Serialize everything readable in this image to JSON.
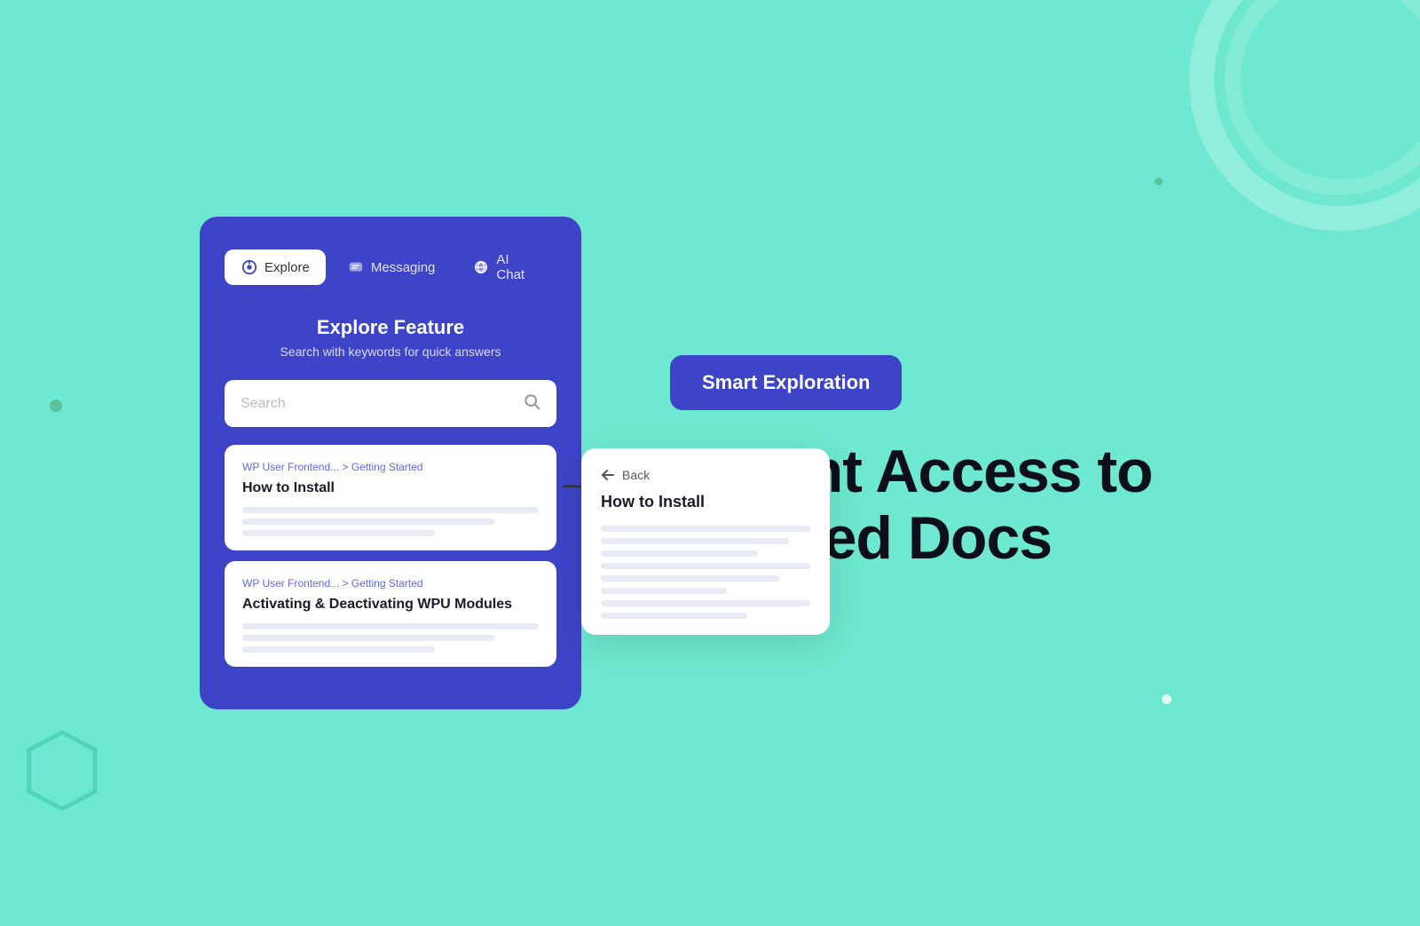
{
  "background": {
    "color": "#6ee8d0"
  },
  "tabs": [
    {
      "id": "explore",
      "label": "Explore",
      "active": true
    },
    {
      "id": "messaging",
      "label": "Messaging",
      "active": false
    },
    {
      "id": "ai-chat",
      "label": "AI Chat",
      "active": false
    }
  ],
  "explore": {
    "title": "Explore Feature",
    "subtitle": "Search with keywords for quick answers",
    "search_placeholder": "Search"
  },
  "doc_cards": [
    {
      "breadcrumb": "WP User Frontend... > Getting Started",
      "title": "How to Install",
      "lines": [
        "full",
        "medium",
        "short"
      ]
    },
    {
      "breadcrumb": "WP User Frontend... > Getting Started",
      "title": "Activating & Deactivating WPU Modules",
      "lines": [
        "full",
        "medium",
        "short"
      ]
    }
  ],
  "detail_card": {
    "back_label": "Back",
    "title": "How to Install",
    "lines": [
      "full",
      "full",
      "medium",
      "full",
      "medium",
      "short",
      "full",
      "medium"
    ]
  },
  "right": {
    "badge": "Smart Exploration",
    "headline_line1": "Instant Access to",
    "headline_line2": "Curated Docs"
  }
}
